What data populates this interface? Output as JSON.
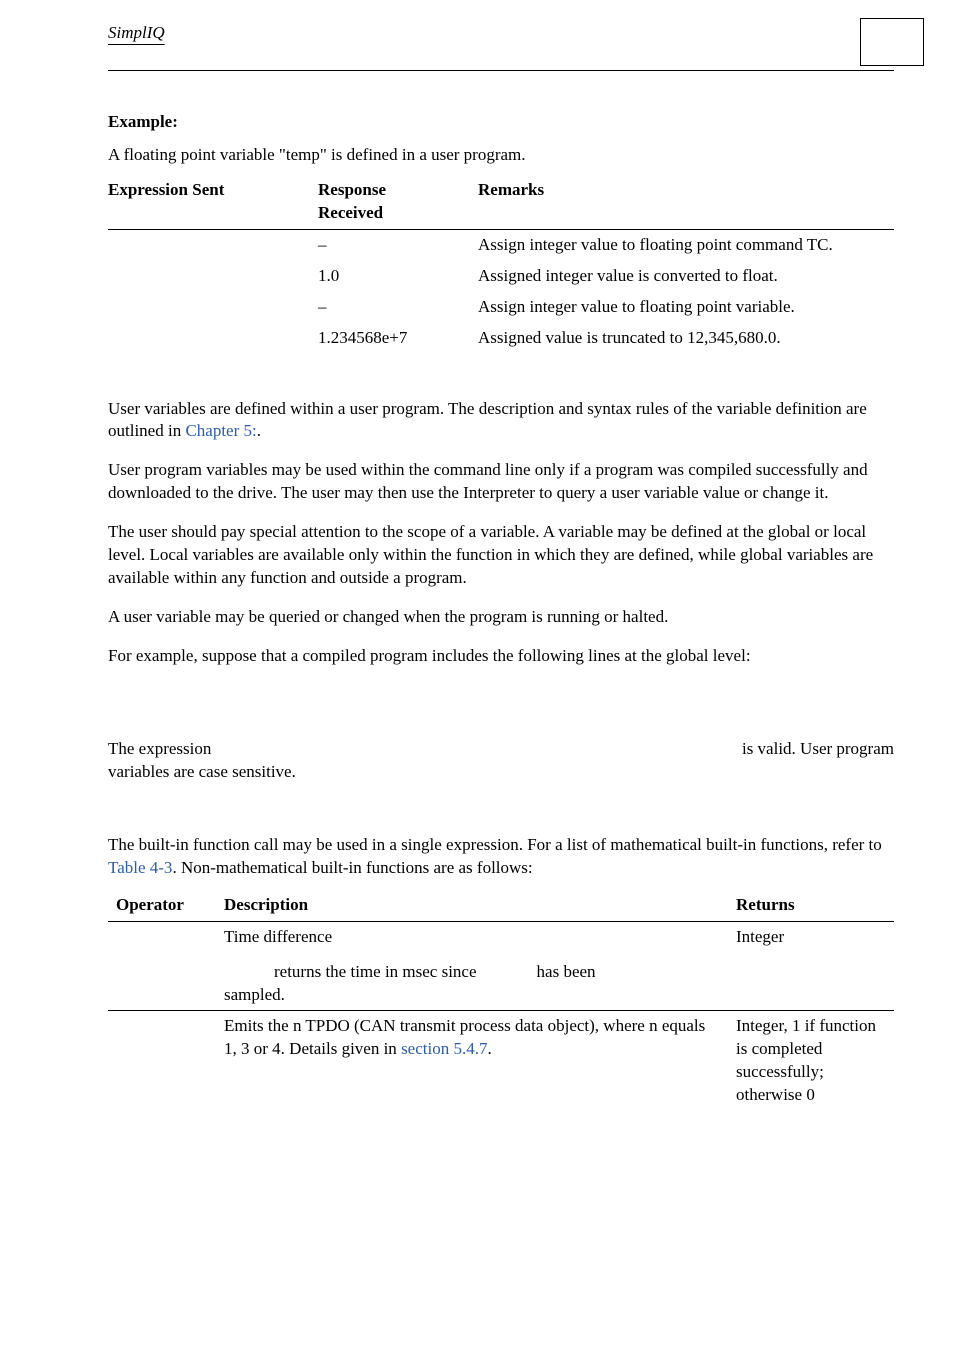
{
  "header": {
    "brand": "SimplIQ"
  },
  "example": {
    "heading": "Example:",
    "intro": "A floating point variable \"temp\" is defined in a user program.",
    "columns": {
      "expr": "Expression Sent",
      "resp_top": "Response",
      "resp_bottom": "Received",
      "remarks": "Remarks"
    },
    "rows": [
      {
        "expr": "",
        "resp": "–",
        "remarks": "Assign integer value to floating point command TC."
      },
      {
        "expr": "",
        "resp": "1.0",
        "remarks": "Assigned integer value is converted to float."
      },
      {
        "expr": "",
        "resp": "–",
        "remarks": "Assign integer value to floating point variable."
      },
      {
        "expr": "",
        "resp": "1.234568e+7",
        "remarks": "Assigned value is truncated to 12,345,680.0."
      }
    ]
  },
  "body": {
    "p1a": "User variables are defined within a user program. The description and syntax rules of the variable definition are outlined in ",
    "p1_link": "Chapter 5:",
    "p1b": ".",
    "p2": "User program variables may be used within the command line only if a program was compiled successfully and downloaded to the drive. The user may then use the Interpreter to query a user variable value or change it.",
    "p3": "The user should pay special attention to the scope of a variable. A variable may be defined at the global or local level. Local variables are available only within the function in which they are defined, while global variables are available within any function and outside a program.",
    "p4": "A user variable may be queried or changed when the program is running or halted.",
    "p5": "For example, suppose that a compiled program includes the following lines at the global level:",
    "p6a": "The expression",
    "p6b": "is valid. User program",
    "p6c": "variables are case sensitive.",
    "p7a": "The built-in function call may be used in a single expression. For a list of mathematical built-in functions, refer to ",
    "p7_link": "Table 4-3",
    "p7b": ". Non-mathematical built-in functions are as follows:"
  },
  "ops": {
    "columns": {
      "op": "Operator",
      "desc": "Description",
      "ret": "Returns"
    },
    "rows": [
      {
        "op": "",
        "desc_main": "Time difference",
        "desc_sub_a": "returns the time in msec since",
        "desc_sub_b": "has been",
        "desc_sub_c": "sampled.",
        "ret": "Integer"
      },
      {
        "op": "",
        "desc_a": "Emits the n TPDO (CAN transmit process data object), where n equals 1, 3 or 4. Details given in ",
        "desc_link": "section 5.4.7",
        "desc_b": ".",
        "ret": "Integer, 1 if function is completed successfully; otherwise 0"
      }
    ]
  }
}
